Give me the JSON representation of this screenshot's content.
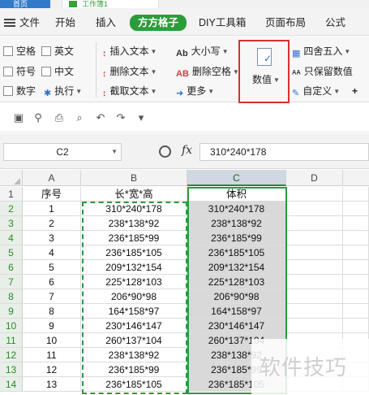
{
  "titlebar": {
    "home_tab": "首页",
    "doc_tab": "工作簿1"
  },
  "menubar": {
    "items": [
      "文件",
      "开始",
      "插入",
      "方方格子",
      "DIY工具箱",
      "页面布局",
      "公式"
    ],
    "active": "方方格子"
  },
  "ribbon": {
    "checkboxes": [
      "空格",
      "英文",
      "符号",
      "中文",
      "数字"
    ],
    "execute_label": "执行",
    "text_tools": [
      "插入文本",
      "删除文本",
      "截取文本"
    ],
    "case_tools": [
      "大小写",
      "删除空格",
      "更多"
    ],
    "number_label": "数值",
    "round_tools": [
      "四舍五入",
      "只保留数值",
      "自定义"
    ]
  },
  "formula_bar": {
    "name_box": "C2",
    "fx_label": "fx",
    "formula": "310*240*178"
  },
  "sheet": {
    "columns": [
      "A",
      "B",
      "C",
      "D"
    ],
    "header_row": {
      "a": "序号",
      "b": "长*宽*高",
      "c": "体积"
    },
    "row_numbers": [
      "1",
      "2",
      "3",
      "4",
      "5",
      "6",
      "7",
      "8",
      "9",
      "10",
      "11",
      "12",
      "13",
      "14"
    ],
    "rows": [
      {
        "a": "1",
        "b": "310*240*178",
        "c": "310*240*178"
      },
      {
        "a": "2",
        "b": "238*138*92",
        "c": "238*138*92"
      },
      {
        "a": "3",
        "b": "236*185*99",
        "c": "236*185*99"
      },
      {
        "a": "4",
        "b": "236*185*105",
        "c": "236*185*105"
      },
      {
        "a": "5",
        "b": "209*132*154",
        "c": "209*132*154"
      },
      {
        "a": "6",
        "b": "225*128*103",
        "c": "225*128*103"
      },
      {
        "a": "7",
        "b": "206*90*98",
        "c": "206*90*98"
      },
      {
        "a": "8",
        "b": "164*158*97",
        "c": "164*158*97"
      },
      {
        "a": "9",
        "b": "230*146*147",
        "c": "230*146*147"
      },
      {
        "a": "10",
        "b": "260*137*104",
        "c": "260*137*104"
      },
      {
        "a": "11",
        "b": "238*138*92",
        "c": "238*138*92"
      },
      {
        "a": "12",
        "b": "236*185*99",
        "c": "236*185*99"
      },
      {
        "a": "13",
        "b": "236*185*105",
        "c": "236*185*105"
      }
    ]
  },
  "watermark": "软件技巧",
  "colors": {
    "accent_green": "#2a9d3a",
    "highlight_red": "#d93030",
    "selection_gray": "#d9d9d9"
  }
}
